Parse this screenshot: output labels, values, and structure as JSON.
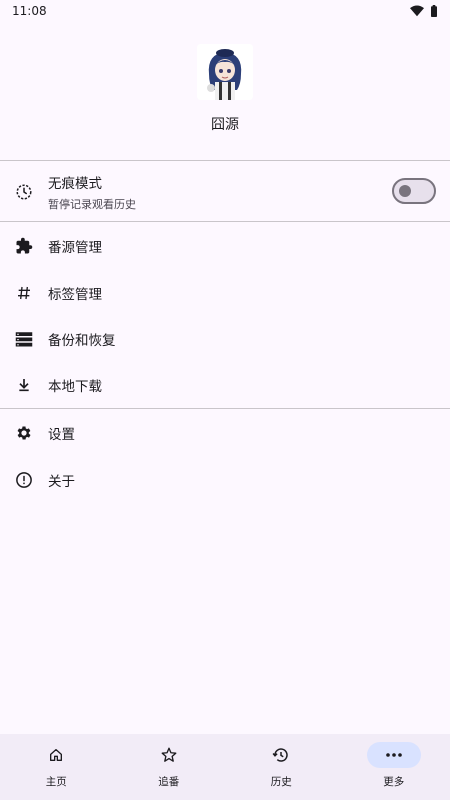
{
  "status": {
    "time": "11:08"
  },
  "profile": {
    "name": "囧源"
  },
  "incognito": {
    "title": "无痕模式",
    "subtitle": "暂停记录观看历史",
    "enabled": false
  },
  "menu": {
    "source_manage": "番源管理",
    "tag_manage": "标签管理",
    "backup_restore": "备份和恢复",
    "local_download": "本地下载",
    "settings": "设置",
    "about": "关于"
  },
  "nav": {
    "home": "主页",
    "follow": "追番",
    "history": "历史",
    "more": "更多",
    "active": "more"
  },
  "colors": {
    "nav_active_pill": "#d9e2ff",
    "background": "#fdf8ff"
  }
}
